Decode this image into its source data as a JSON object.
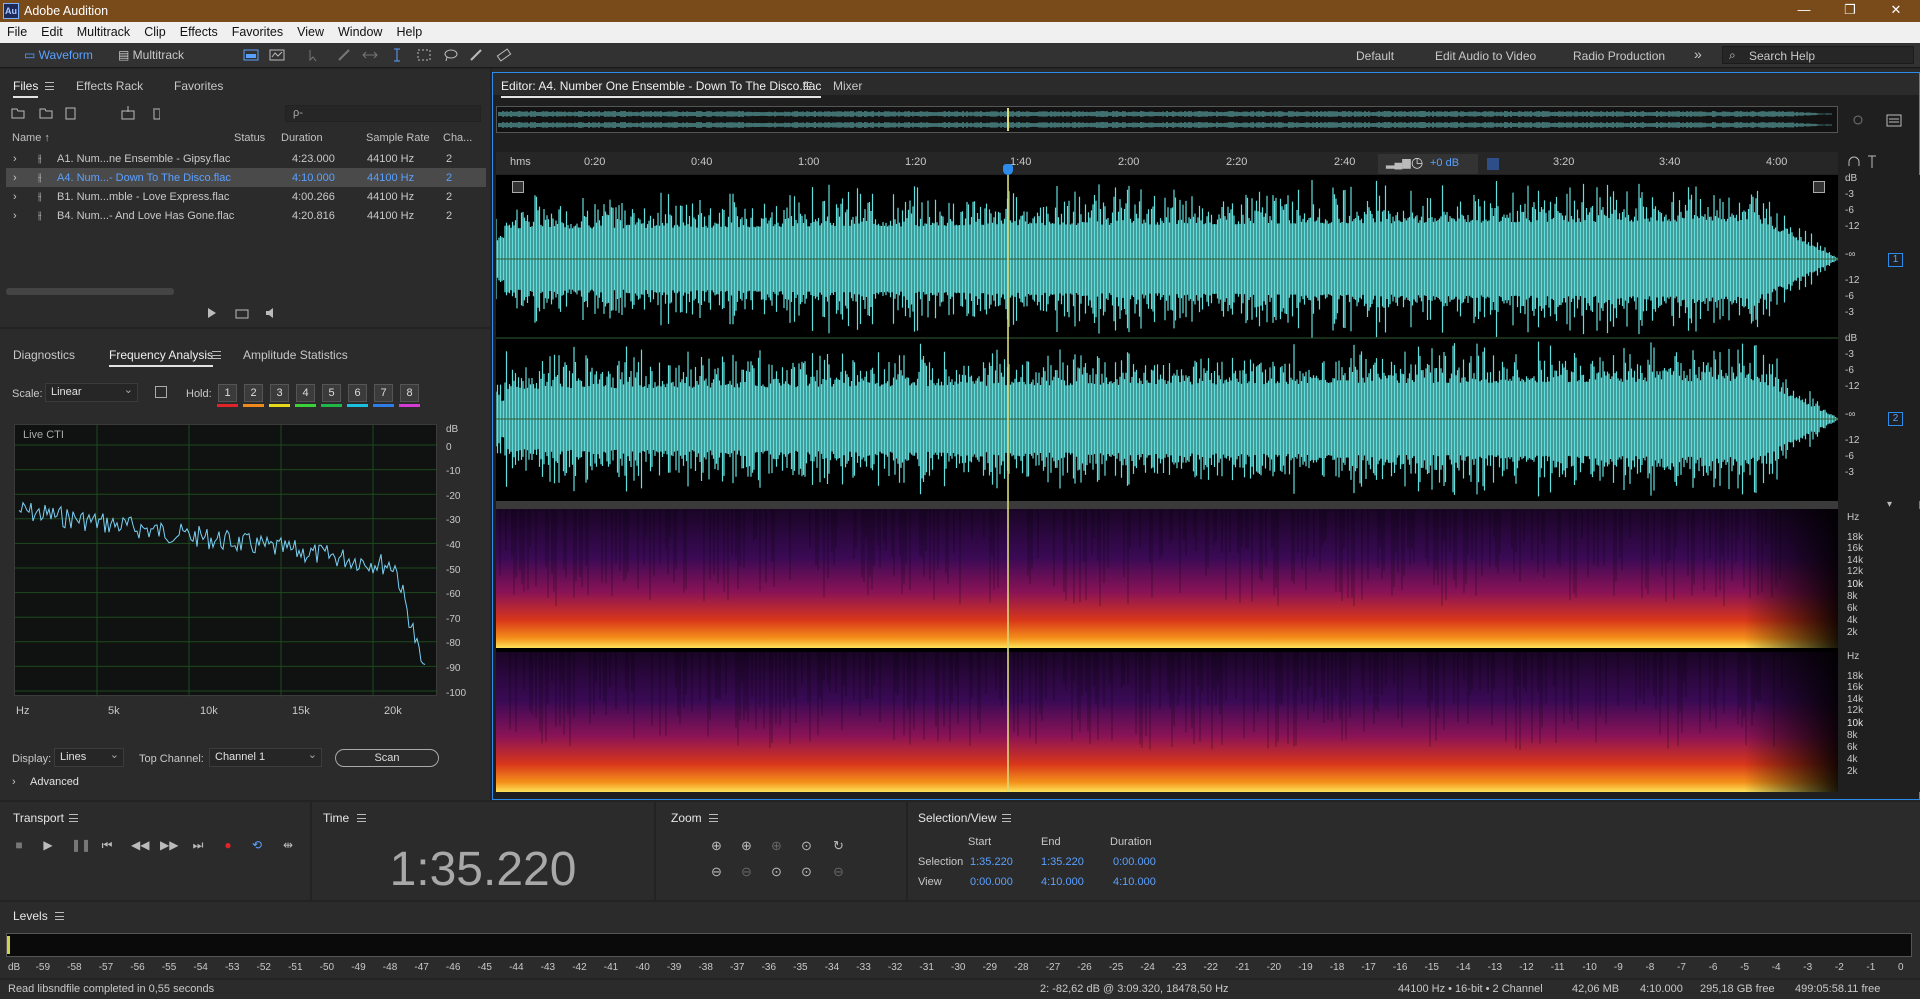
{
  "app": {
    "title": "Adobe Audition",
    "logo": "Au"
  },
  "menu": [
    "File",
    "Edit",
    "Multitrack",
    "Clip",
    "Effects",
    "Favorites",
    "View",
    "Window",
    "Help"
  ],
  "toolbar": {
    "waveform": "Waveform",
    "multitrack": "Multitrack",
    "workspaces": [
      "Default",
      "Edit Audio to Video",
      "Radio Production"
    ],
    "more": "»",
    "search_placeholder": "Search Help"
  },
  "files": {
    "tabs": [
      "Files",
      "Effects Rack",
      "Favorites"
    ],
    "columns": [
      "Name ↑",
      "Status",
      "Duration",
      "Sample Rate",
      "Cha..."
    ],
    "rows": [
      {
        "name": "A1. Num...ne Ensemble - Gipsy.flac",
        "duration": "4:23.000",
        "rate": "44100 Hz",
        "ch": "2",
        "selected": false
      },
      {
        "name": "A4. Num...- Down To The Disco.flac",
        "duration": "4:10.000",
        "rate": "44100 Hz",
        "ch": "2",
        "selected": true
      },
      {
        "name": "B1. Num...mble - Love Express.flac",
        "duration": "4:00.266",
        "rate": "44100 Hz",
        "ch": "2",
        "selected": false
      },
      {
        "name": "B4. Num...- And Love Has Gone.flac",
        "duration": "4:20.816",
        "rate": "44100 Hz",
        "ch": "2",
        "selected": false
      }
    ],
    "search_placeholder": "ρ-"
  },
  "analysis": {
    "tabs": [
      "Diagnostics",
      "Frequency Analysis",
      "Amplitude Statistics"
    ],
    "scale_label": "Scale:",
    "scale_value": "Linear",
    "hold_label": "Hold:",
    "hold": [
      "1",
      "2",
      "3",
      "4",
      "5",
      "6",
      "7",
      "8"
    ],
    "hold_colors": [
      "#e0242a",
      "#f08a1c",
      "#e6d81a",
      "#3ad13a",
      "#1fb848",
      "#1ac0e0",
      "#2e7de6",
      "#d43ad4"
    ],
    "graph_label": "Live CTI",
    "db_labels": [
      "dB",
      "0",
      "-10",
      "-20",
      "-30",
      "-40",
      "-50",
      "-60",
      "-70",
      "-80",
      "-90",
      "-100"
    ],
    "hz_labels": [
      "Hz",
      "5k",
      "10k",
      "15k",
      "20k"
    ],
    "display_label": "Display:",
    "display_value": "Lines",
    "top_channel_label": "Top Channel:",
    "top_channel_value": "Channel 1",
    "scan": "Scan",
    "advanced": "Advanced"
  },
  "editor": {
    "tab": "Editor: A4. Number One Ensemble - Down To The Disco.flac",
    "mixer": "Mixer",
    "ruler": [
      "hms",
      "0:20",
      "0:40",
      "1:00",
      "1:20",
      "1:40",
      "2:00",
      "2:20",
      "2:40",
      "3:20",
      "3:40",
      "4:00"
    ],
    "hud_gain": "+0 dB",
    "wave_db": [
      "dB",
      "-3",
      "-6",
      "-12",
      "-∞",
      "-12",
      "-6",
      "-3"
    ],
    "channels": [
      "1",
      "2"
    ],
    "spec_hz": [
      "Hz",
      "18k",
      "16k",
      "14k",
      "12k",
      "10k",
      "8k",
      "6k",
      "4k",
      "2k"
    ],
    "colors": {
      "waveform": "#62dfdd",
      "playhead": "#d8dc7a",
      "accent": "#2d8ceb"
    }
  },
  "transport": {
    "title": "Transport"
  },
  "time": {
    "title": "Time",
    "value": "1:35.220"
  },
  "zoom": {
    "title": "Zoom"
  },
  "selection": {
    "title": "Selection/View",
    "headers": [
      "Start",
      "End",
      "Duration"
    ],
    "rows": [
      {
        "label": "Selection",
        "start": "1:35.220",
        "end": "1:35.220",
        "duration": "0:00.000"
      },
      {
        "label": "View",
        "start": "0:00.000",
        "end": "4:10.000",
        "duration": "4:10.000"
      }
    ]
  },
  "levels": {
    "title": "Levels",
    "scale": [
      "dB",
      "-59",
      "-58",
      "-57",
      "-56",
      "-55",
      "-54",
      "-53",
      "-52",
      "-51",
      "-50",
      "-49",
      "-48",
      "-47",
      "-46",
      "-45",
      "-44",
      "-43",
      "-42",
      "-41",
      "-40",
      "-39",
      "-38",
      "-37",
      "-36",
      "-35",
      "-34",
      "-33",
      "-32",
      "-31",
      "-30",
      "-29",
      "-28",
      "-27",
      "-26",
      "-25",
      "-24",
      "-23",
      "-22",
      "-21",
      "-20",
      "-19",
      "-18",
      "-17",
      "-16",
      "-15",
      "-14",
      "-13",
      "-12",
      "-11",
      "-10",
      "-9",
      "-8",
      "-7",
      "-6",
      "-5",
      "-4",
      "-3",
      "-2",
      "-1",
      "0"
    ]
  },
  "status": {
    "message": "Read libsndfile completed in 0,55 seconds",
    "cursor": "2: -82,62 dB @ 3:09.320, 18478,50 Hz",
    "format": "44100 Hz • 16-bit • 2 Channel",
    "size": "42,06 MB",
    "duration": "4:10.000",
    "free": "295,18 GB free",
    "free_time": "499:05:58.11 free"
  }
}
